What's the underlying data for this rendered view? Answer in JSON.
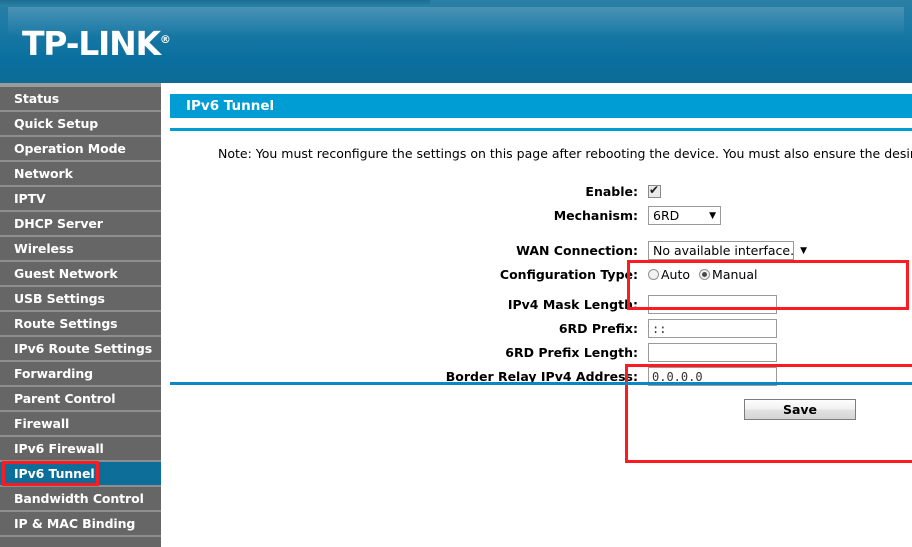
{
  "brand": {
    "name": "TP-LINK",
    "trademark": "®"
  },
  "sidebar": {
    "items": [
      {
        "label": "Status",
        "selected": false
      },
      {
        "label": "Quick Setup",
        "selected": false
      },
      {
        "label": "Operation Mode",
        "selected": false
      },
      {
        "label": "Network",
        "selected": false
      },
      {
        "label": "IPTV",
        "selected": false
      },
      {
        "label": "DHCP Server",
        "selected": false
      },
      {
        "label": "Wireless",
        "selected": false
      },
      {
        "label": "Guest Network",
        "selected": false
      },
      {
        "label": "USB Settings",
        "selected": false
      },
      {
        "label": "Route Settings",
        "selected": false
      },
      {
        "label": "IPv6 Route Settings",
        "selected": false
      },
      {
        "label": "Forwarding",
        "selected": false
      },
      {
        "label": "Parent Control",
        "selected": false
      },
      {
        "label": "Firewall",
        "selected": false
      },
      {
        "label": "IPv6 Firewall",
        "selected": false
      },
      {
        "label": "IPv6 Tunnel",
        "selected": true
      },
      {
        "label": "Bandwidth Control",
        "selected": false
      },
      {
        "label": "IP & MAC Binding",
        "selected": false
      }
    ]
  },
  "page": {
    "title": "IPv6 Tunnel",
    "note": "Note: You must reconfigure the settings on this page after rebooting the device. You must also ensure the desired W."
  },
  "form": {
    "enable": {
      "label": "Enable:",
      "checked": true
    },
    "mechanism": {
      "label": "Mechanism:",
      "value": "6RD",
      "arrow": "▼"
    },
    "wan_connection": {
      "label": "WAN Connection:",
      "value": "No available interface.",
      "arrow": "▼"
    },
    "configuration_type": {
      "label": "Configuration Type:",
      "options": [
        "Auto",
        "Manual"
      ],
      "selected": "Manual"
    },
    "ipv4_mask_length": {
      "label": "IPv4 Mask Length:",
      "value": ""
    },
    "rd_prefix": {
      "label": "6RD Prefix:",
      "value": "::"
    },
    "rd_prefix_length": {
      "label": "6RD Prefix Length:",
      "value": ""
    },
    "border_relay": {
      "label": "Border Relay IPv4 Address:",
      "value": "0.0.0.0"
    }
  },
  "actions": {
    "save_label": "Save"
  },
  "colors": {
    "brand_blue": "#0a6f9e",
    "title_blue": "#009cd4",
    "sidebar_gray": "#666666",
    "selected_blue": "#0c6e99",
    "highlight_red": "#fc1b20"
  }
}
